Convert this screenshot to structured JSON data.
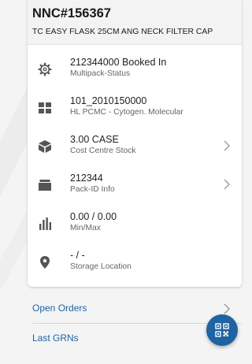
{
  "header": {
    "title": "NNC#156367",
    "subtitle": "TC EASY FLASK 25CM ANG NECK FILTER CAP"
  },
  "details": [
    {
      "icon": "gear-icon",
      "primary": "212344000 Booked In",
      "secondary": "Multipack-Status",
      "has_chevron": false
    },
    {
      "icon": "grid-icon",
      "primary": "101_2010150000",
      "secondary": "HL PCMC - Cytogen. Molecular",
      "has_chevron": false
    },
    {
      "icon": "box-icon",
      "primary": "3.00 CASE",
      "secondary": "Cost Centre Stock",
      "has_chevron": true
    },
    {
      "icon": "package-icon",
      "primary": "212344",
      "secondary": "Pack-ID Info",
      "has_chevron": true
    },
    {
      "icon": "bar-chart-icon",
      "primary": "0.00 / 0.00",
      "secondary": "Min/Max",
      "has_chevron": false
    },
    {
      "icon": "location-pin-icon",
      "primary": "- / -",
      "secondary": "Storage Location",
      "has_chevron": false
    }
  ],
  "links": [
    {
      "label": "Open Orders"
    },
    {
      "label": "Last GRNs"
    }
  ],
  "fab": {
    "icon": "qr-code-icon"
  },
  "colors": {
    "accent": "#1f63a3",
    "icon": "#555555",
    "card_header_bg": "#f3f3f3"
  }
}
